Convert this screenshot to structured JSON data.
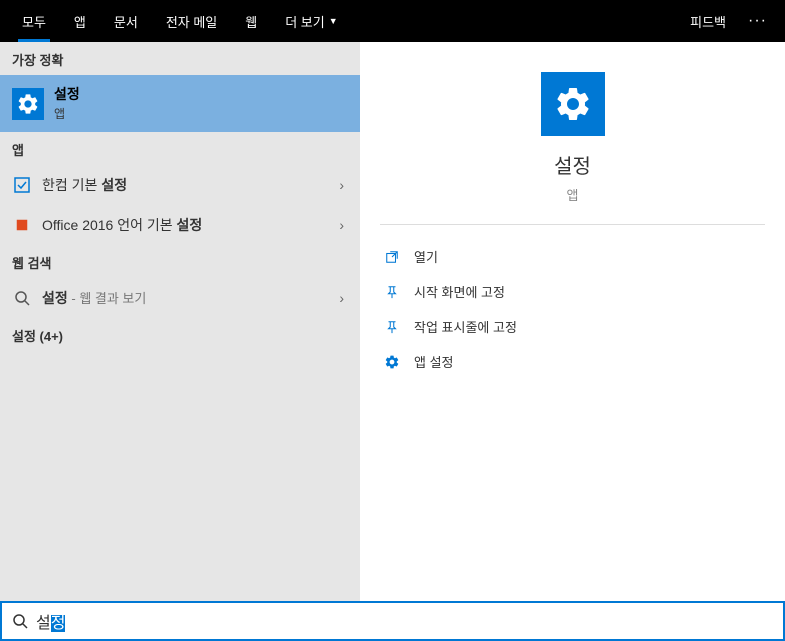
{
  "topnav": {
    "tabs": [
      {
        "label": "모두",
        "active": true
      },
      {
        "label": "앱"
      },
      {
        "label": "문서"
      },
      {
        "label": "전자 메일"
      },
      {
        "label": "웹"
      },
      {
        "label": "더 보기",
        "hasDropdown": true
      }
    ],
    "feedback": "피드백",
    "more": "···"
  },
  "left": {
    "bestMatch": {
      "header": "가장 정확",
      "title": "설정",
      "subtitle": "앱"
    },
    "apps": {
      "header": "앱",
      "items": [
        {
          "title_prefix": "한컴 기본 ",
          "title_bold": "설정"
        },
        {
          "title_prefix": "Office 2016 언어 기본 ",
          "title_bold": "설정"
        }
      ]
    },
    "webSearch": {
      "header": "웹 검색",
      "title_bold": "설정",
      "hint": " - 웹 결과 보기"
    },
    "moreHeader": "설정 (4+)"
  },
  "preview": {
    "title": "설정",
    "subtitle": "앱",
    "actions": [
      {
        "icon": "open",
        "label": "열기"
      },
      {
        "icon": "pin",
        "label": "시작 화면에 고정"
      },
      {
        "icon": "pin",
        "label": "작업 표시줄에 고정"
      },
      {
        "icon": "gear",
        "label": "앱 설정"
      }
    ]
  },
  "search": {
    "text_normal": "설",
    "text_selected": "정"
  }
}
